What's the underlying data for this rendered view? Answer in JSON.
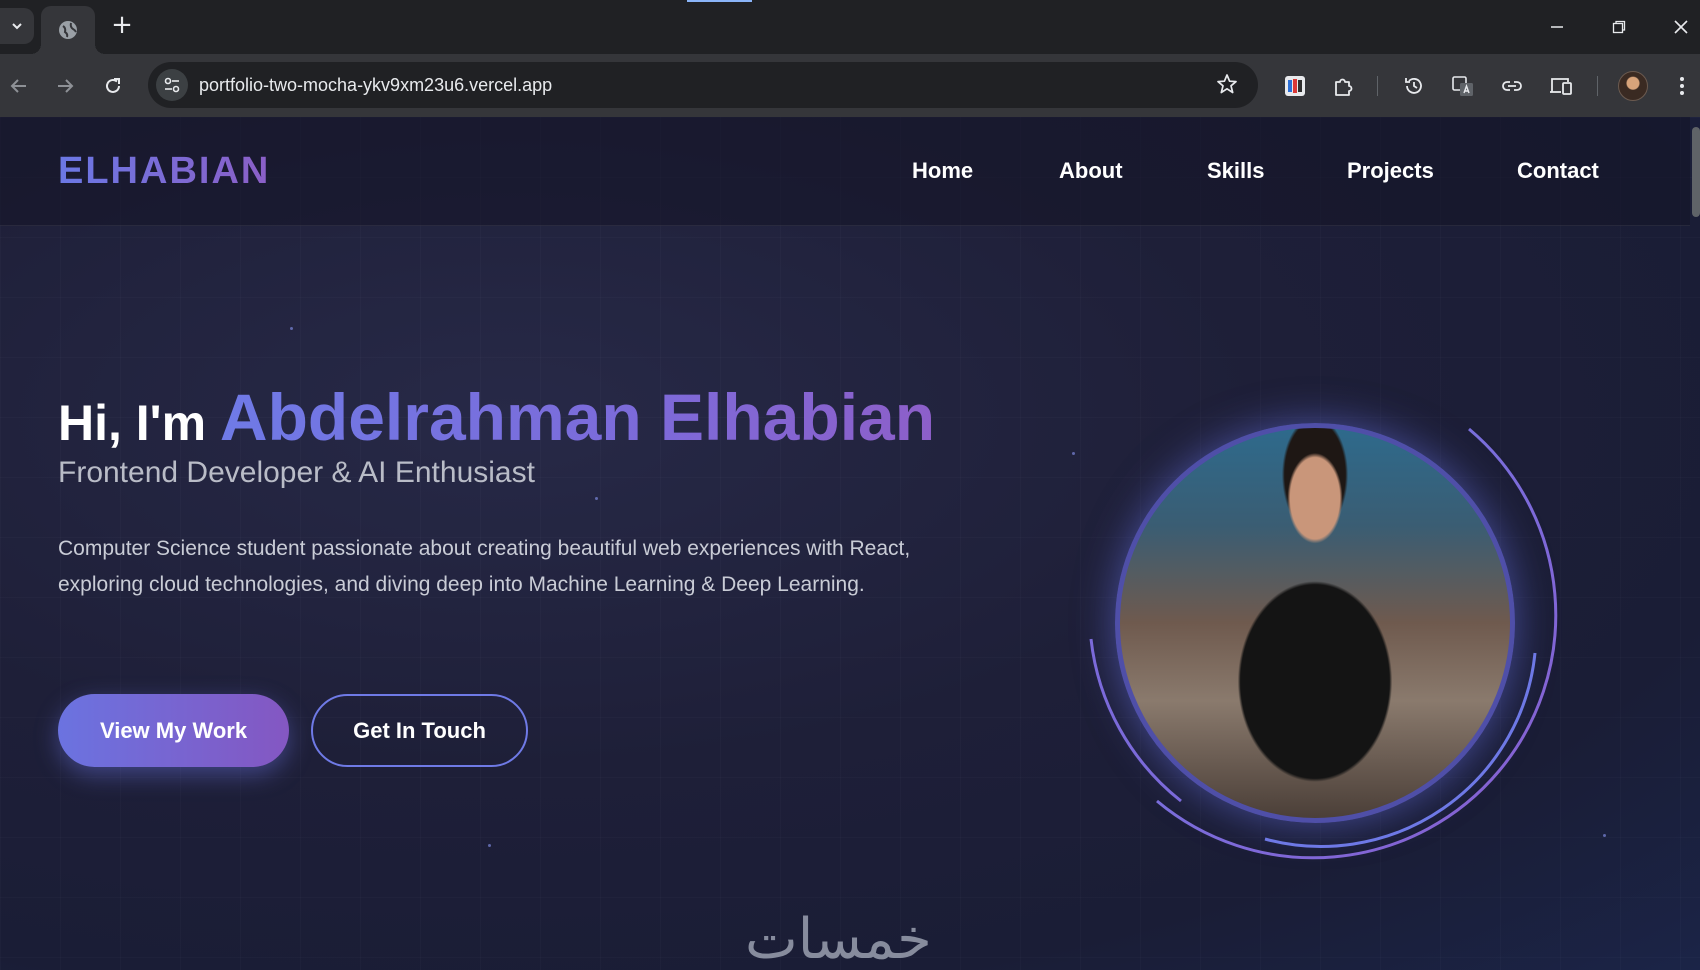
{
  "browser": {
    "url": "portfolio-two-mocha-ykv9xm23u6.vercel.app",
    "new_tab_glyph": "+"
  },
  "site": {
    "logo": "ELHABIAN",
    "nav": [
      {
        "label": "Home"
      },
      {
        "label": "About"
      },
      {
        "label": "Skills"
      },
      {
        "label": "Projects"
      },
      {
        "label": "Contact"
      }
    ]
  },
  "hero": {
    "greeting": "Hi, I'm ",
    "name": "Abdelrahman Elhabian",
    "subtitle": "Frontend Developer & AI Enthusiast",
    "description": "Computer Science student passionate about creating beautiful web experiences with React, exploring cloud technologies, and diving deep into Machine Learning & Deep Learning.",
    "primary_button": "View My Work",
    "secondary_button": "Get In Touch"
  },
  "watermark": "خمسات",
  "colors": {
    "accent": "#6f7ae6",
    "accent_purple": "#8457c2",
    "background": "#1e1f38"
  },
  "icons": [
    "tab-search-icon",
    "globe-icon",
    "minimize-icon",
    "restore-icon",
    "close-icon",
    "back-icon",
    "forward-icon",
    "reload-icon",
    "site-info-icon",
    "bookmark-star-icon",
    "extension-app-icon",
    "puzzle-icon",
    "history-icon",
    "translate-icon",
    "link-icon",
    "devices-icon",
    "profile-avatar-icon",
    "menu-dots-icon"
  ]
}
